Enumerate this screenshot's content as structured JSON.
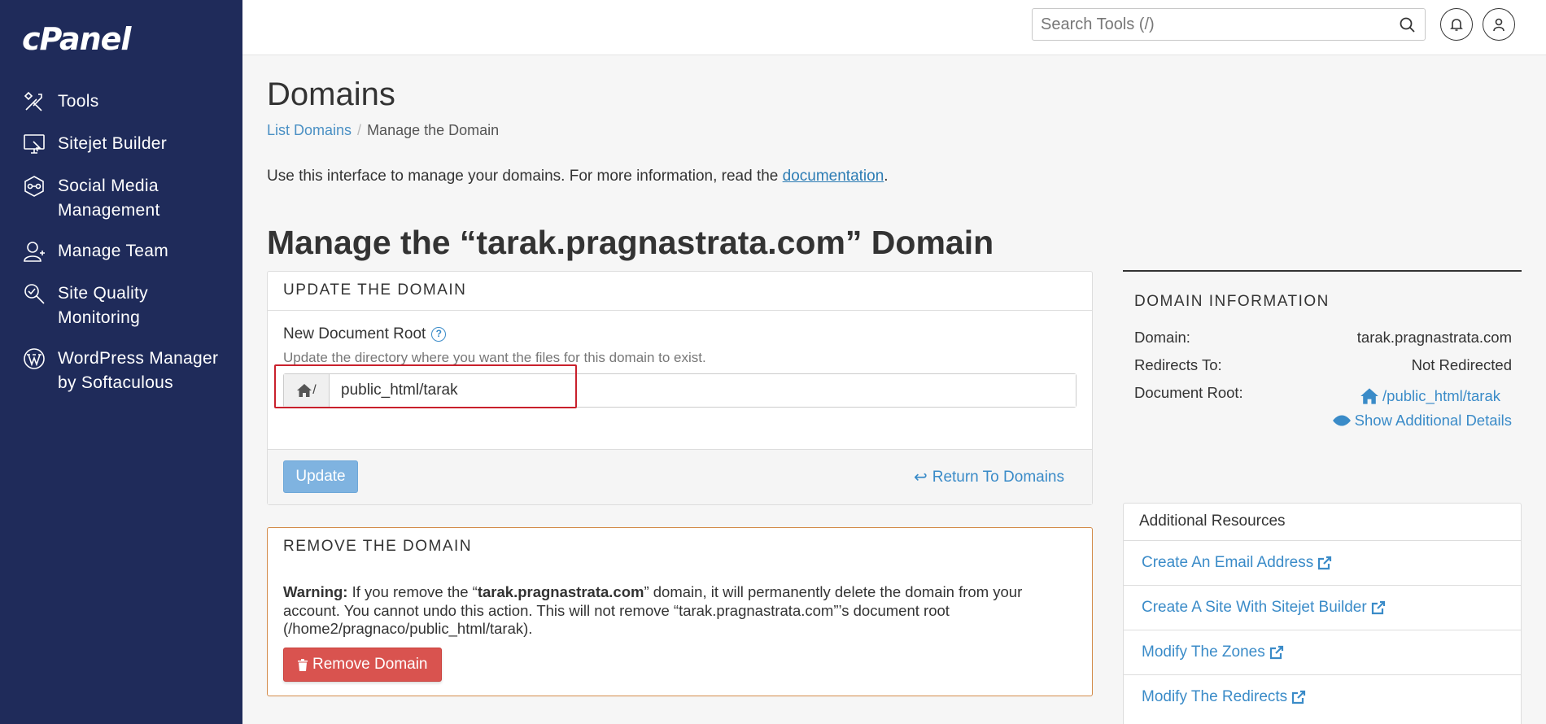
{
  "sidebar": {
    "logo": "cPanel",
    "items": [
      {
        "label": "Tools",
        "icon": "tools-icon"
      },
      {
        "label": "Sitejet Builder",
        "icon": "sitejet-icon"
      },
      {
        "label": "Social Media Management",
        "icon": "social-media-icon"
      },
      {
        "label": "Manage Team",
        "icon": "team-icon"
      },
      {
        "label": "Site Quality Monitoring",
        "icon": "site-quality-icon"
      },
      {
        "label": "WordPress Manager by Softaculous",
        "icon": "wordpress-icon"
      }
    ]
  },
  "topbar": {
    "search_placeholder": "Search Tools (/)"
  },
  "page": {
    "title": "Domains",
    "breadcrumb": {
      "parent": "List Domains",
      "current": "Manage the Domain"
    },
    "intro_prefix": "Use this interface to manage your domains. For more information, read the ",
    "intro_link": "documentation",
    "intro_suffix": ".",
    "manage_heading": "Manage the “tarak.pragnastrata.com” Domain"
  },
  "update_panel": {
    "heading": "UPDATE THE DOMAIN",
    "field_label": "New Document Root",
    "help_text": "Update the directory where you want the files for this domain to exist.",
    "addon_text": "/",
    "document_root_value": "public_html/tarak",
    "update_label": "Update",
    "return_label": "Return To Domains"
  },
  "remove_panel": {
    "heading": "REMOVE THE DOMAIN",
    "warning_label": "Warning:",
    "warning_part1": " If you remove the “",
    "domain": "tarak.pragnastrata.com",
    "warning_part2": "” domain, it will permanently delete the domain from your account. You cannot undo this action. This will not remove “tarak.pragnastrata.com”’s document root (/home2/pragnaco/public_html/tarak).",
    "remove_label": "Remove Domain"
  },
  "domain_info": {
    "heading": "DOMAIN INFORMATION",
    "domain_label": "Domain:",
    "domain_value": "tarak.pragnastrata.com",
    "redirects_label": "Redirects To:",
    "redirects_value": "Not Redirected",
    "docroot_label": "Document Root:",
    "docroot_value": "/public_html/tarak",
    "show_details": "Show Additional Details"
  },
  "resources": {
    "heading": "Additional Resources",
    "items": [
      "Create An Email Address",
      "Create A Site With Sitejet Builder",
      "Modify The Zones",
      "Modify The Redirects"
    ]
  }
}
